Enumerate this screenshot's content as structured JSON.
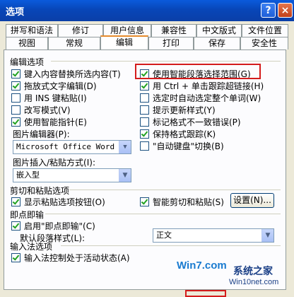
{
  "window": {
    "title": "选项",
    "help_glyph": "?",
    "close_glyph": "×"
  },
  "tabs_row1": [
    "拼写和语法",
    "修订",
    "用户信息",
    "兼容性",
    "中文版式",
    "文件位置"
  ],
  "tabs_row2": [
    "视图",
    "常规",
    "编辑",
    "打印",
    "保存",
    "安全性"
  ],
  "active_tab": "编辑",
  "edit": {
    "section_title": "编辑选项",
    "left": [
      {
        "label": "键入内容替换所选内容(T)",
        "checked": true
      },
      {
        "label": "拖放式文字编辑(D)",
        "checked": true
      },
      {
        "label": "用 INS 键粘贴(I)",
        "checked": false
      },
      {
        "label": "改写模式(V)",
        "checked": false
      },
      {
        "label": "使用智能指针(E)",
        "checked": true
      }
    ],
    "right": [
      {
        "label": "使用智能段落选择范围(G)",
        "checked": true
      },
      {
        "label": "用 Ctrl + 单击跟踪超链接(H)",
        "checked": true
      },
      {
        "label": "选定时自动选定整个单词(W)",
        "checked": false
      },
      {
        "label": "提示更新样式(Y)",
        "checked": false
      },
      {
        "label": "标记格式不一致错误(P)",
        "checked": false
      },
      {
        "label": "保持格式跟踪(K)",
        "checked": true
      },
      {
        "label": "\"自动键盘\"切换(B)",
        "checked": false
      }
    ],
    "picture_editor_label": "图片编辑器(P):",
    "picture_editor_value": "Microsoft Office Word",
    "insert_paste_label": "图片插入/粘贴方式(I):",
    "insert_paste_value": "嵌入型"
  },
  "cutpaste": {
    "section_title": "剪切和粘贴选项",
    "show_paste_buttons": {
      "label": "显示粘贴选项按钮(O)",
      "checked": true
    },
    "smart_cut": {
      "label": "智能剪切和粘贴(S)",
      "checked": true
    },
    "settings_button": "设置(N)..."
  },
  "clicktype": {
    "section_title": "即点即输",
    "enable": {
      "label": "启用\"即点即输\"(C)",
      "checked": true
    },
    "default_style_label": "默认段落样式(L):",
    "default_style_value": "正文"
  },
  "ime": {
    "section_title": "输入法选项",
    "control": {
      "label": "输入法控制处于活动状态(A)",
      "checked": true
    }
  },
  "watermark": {
    "brand": "Win7.com",
    "line1": "系统之家",
    "line2": "Win10net.com"
  }
}
